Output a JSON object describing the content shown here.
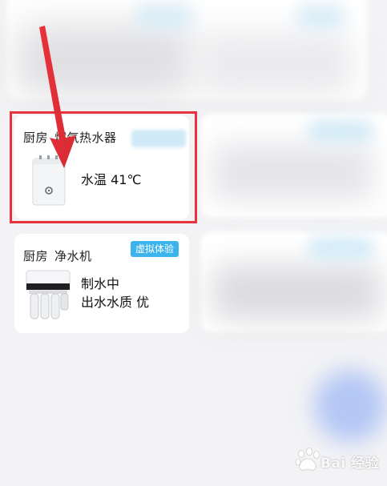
{
  "devices": [
    {
      "room": "厨房",
      "name": "燃气热水器",
      "status_line1": "水温 41℃",
      "icon": "water-heater-icon"
    },
    {
      "room": "厨房",
      "name": "净水机",
      "tag": "虚拟体验",
      "status_line1": "制水中",
      "status_line2": "出水水质 优",
      "icon": "water-purifier-icon"
    }
  ],
  "colors": {
    "highlight": "#e8323c",
    "tag": "#3bb3ec",
    "card": "#ffffff",
    "background": "#f3f3f5"
  },
  "watermark": {
    "text": "Bai 经验"
  }
}
